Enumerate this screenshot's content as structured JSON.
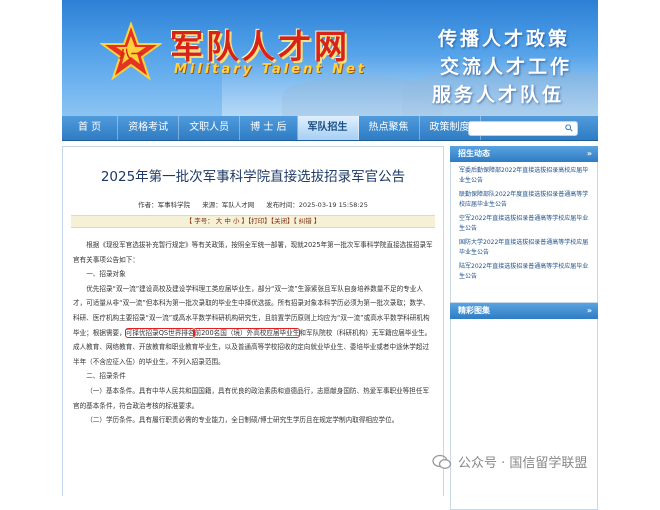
{
  "site": {
    "logo_cn": "军队人才网",
    "logo_en": "Military Talent Net",
    "slogans": [
      "传播人才政策",
      "交流人才工作",
      "服务人才队伍"
    ]
  },
  "nav": [
    {
      "label": "首 页"
    },
    {
      "label": "资格考试"
    },
    {
      "label": "文职人员"
    },
    {
      "label": "博 士 后"
    },
    {
      "label": "军队招生",
      "active": true
    },
    {
      "label": "热点聚焦"
    },
    {
      "label": "政策制度"
    }
  ],
  "article": {
    "title": "2025年第一批次军事科学院直接选拔招录军官公告",
    "author": "作者：军事科学院",
    "source": "来源：军队人才网",
    "date": "发布时间：2025-03-19 15:58:25",
    "toolbar": "【 字号： 大  中  小 】【打印】【关闭】【 纠错 】",
    "para1": "根据《现役军官选拔补充暂行规定》等有关政策，按照全军统一部署，现就2025年第一批次军事科学院直接选拔招录军官有关事项公告如下：",
    "sec1": "一、招录对象",
    "para2a": "优先招录“双一流”建设高校及建设学科理工类应届毕业生，部分“双一流”生源紧张且军队自身培养数量不足的专业人才，可适量从非“双一流”但本科为第一批次录取的毕业生中择优选拔。所有招录对象本科学历必须为第一批次录取；数学、科研、医疗机构主要招录“双一流”或高水平数学科研机构研究生，且前置学历原则上均应为“双一流”或高水平数学科研机构毕业；根据需要，",
    "para2_hl1": "可择优招录QS世界排名",
    "para2_hl2": "前200名国（境）外高校应届毕业生",
    "para2b": "和军队院校（科研机构）无军籍应届毕业生。成人教育、网络教育、开放教育和职业教育毕业生，以及普通高等学校招收的定向就业毕业生、委培毕业或者中途休学超过半年（不含应征入伍）的毕业生，不列入招录范围。",
    "sec2": "二、招录条件",
    "para3": "（一）基本条件。具有中华人民共和国国籍，具有优良的政治素质和道德品行，志愿献身国防、热爱军事职业等担任军官的基本条件，符合政治考核的标准要求。",
    "para4": "（二）学历条件。具有履行职责必需的专业能力，全日制硕/博士研究生学历且在规定学制内取得相应学位。"
  },
  "sidebar": {
    "heading1": "招生动态",
    "more": "»",
    "items": [
      "军委后勤保障部2022年直接选拔招录高校应届毕业生公告",
      "联勤保障部队2022年度直接选拔招录普通高等学校应届毕业生公告",
      "空军2022年直接选拔招录普通高等学校应届毕业生公告",
      "国防大学2022年直接选拔招录普通高等学校应届毕业生公告",
      "陆军2022年直接选拔招录普通高等学校应届毕业生公告"
    ],
    "heading2": "精彩图集"
  },
  "watermark": "公众号 · 国信留学联盟",
  "colors": {
    "nav_blue": "#2f7cc4",
    "title_blue": "#1f3a66",
    "highlight_red": "#e02020",
    "logo_red": "#d8231a"
  }
}
